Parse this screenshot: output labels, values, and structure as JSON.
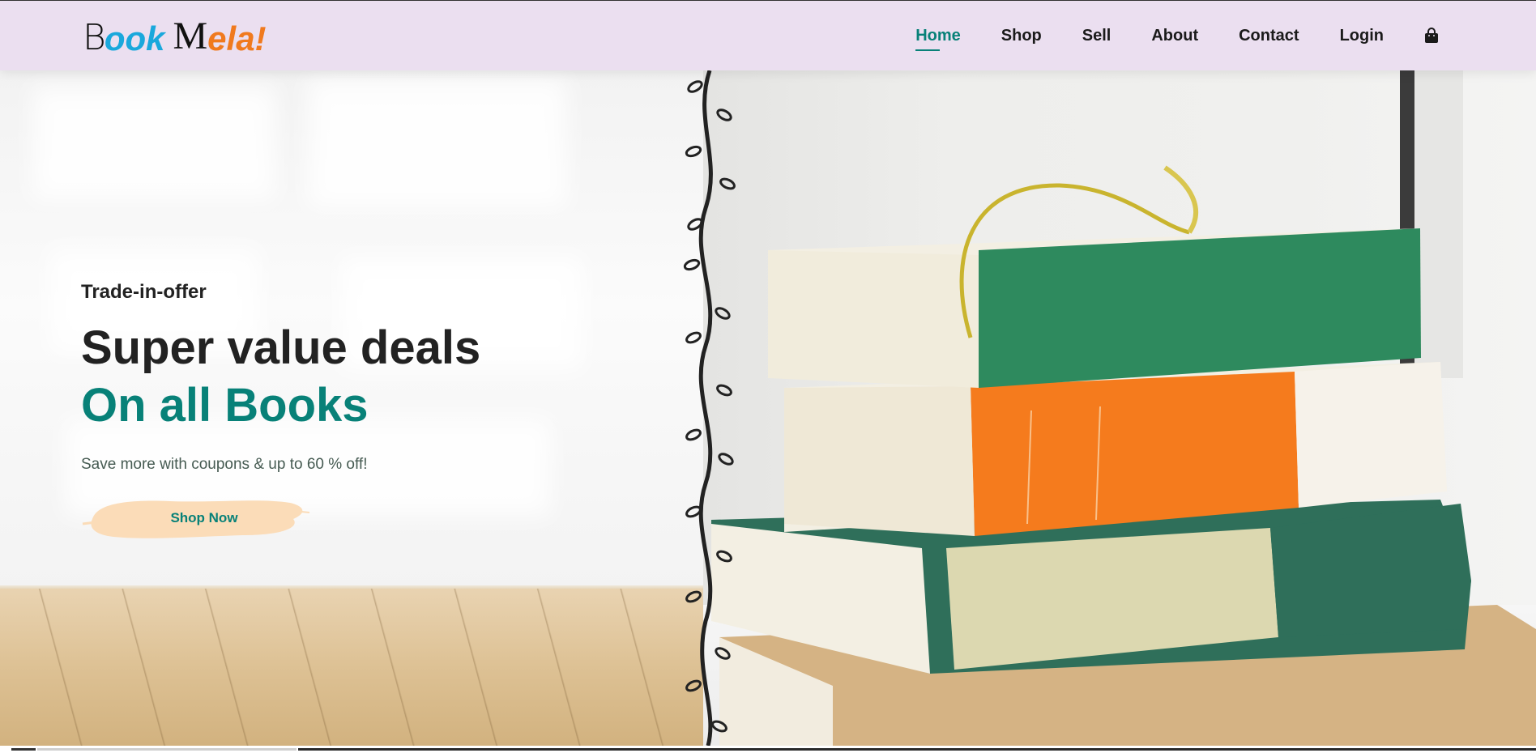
{
  "brand": {
    "logo_parts": [
      "B",
      "ook",
      "M",
      "ela!"
    ],
    "colors": {
      "ook": "#1aa8dc",
      "ela": "#f07a1e",
      "accent": "#088178",
      "header_bg": "#ebdff0"
    }
  },
  "nav": {
    "items": [
      {
        "label": "Home",
        "active": true
      },
      {
        "label": "Shop",
        "active": false
      },
      {
        "label": "Sell",
        "active": false
      },
      {
        "label": "About",
        "active": false
      },
      {
        "label": "Contact",
        "active": false
      },
      {
        "label": "Login",
        "active": false
      }
    ],
    "cart_icon": "shopping-bag-icon"
  },
  "hero": {
    "kicker": "Trade-in-offer",
    "headline": "Super value deals",
    "headline_accent": "On all Books",
    "subtext": "Save more with coupons & up to 60 % off!",
    "cta_label": "Shop Now",
    "image": "stack-of-books-illustration",
    "divider": "vine-divider"
  }
}
